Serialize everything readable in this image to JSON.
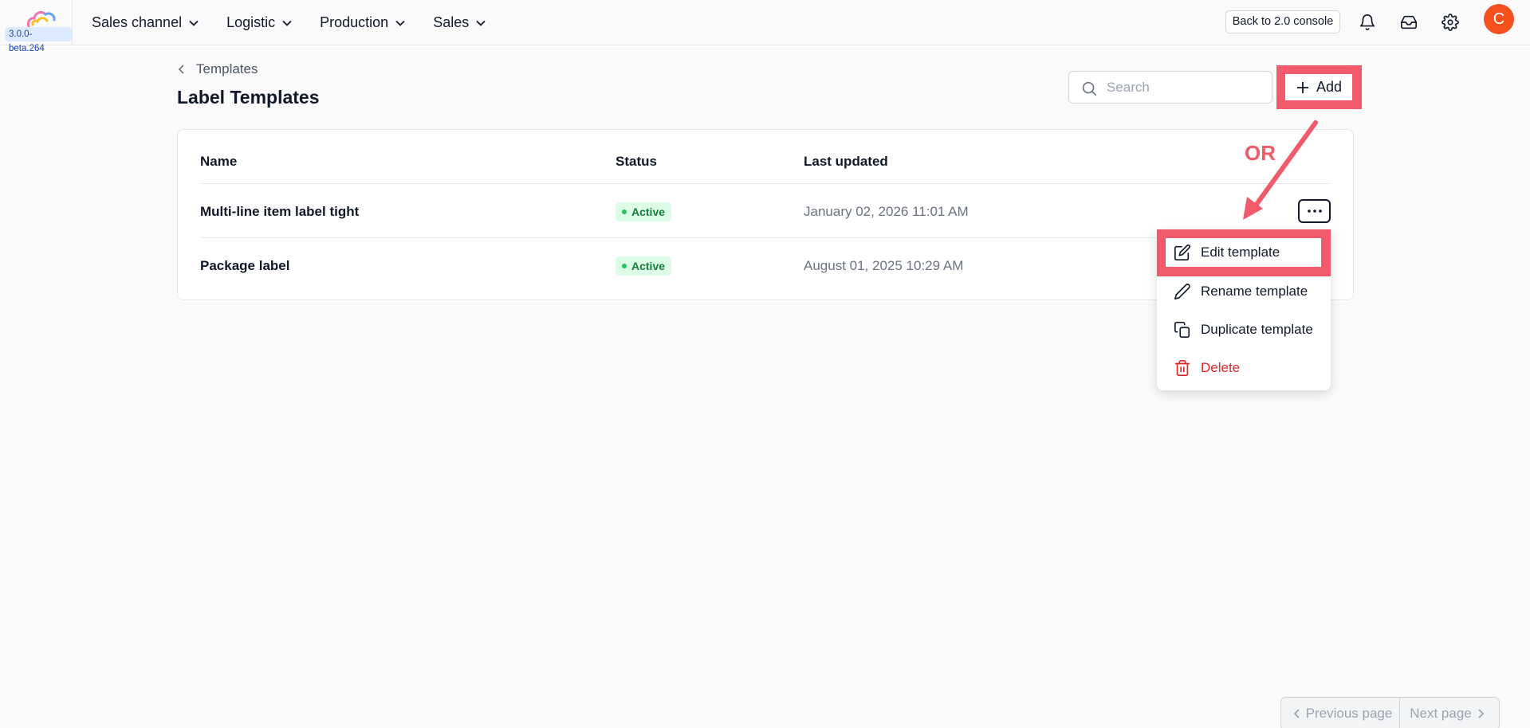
{
  "topbar": {
    "version": "3.0.0-beta.264",
    "nav": [
      {
        "label": "Sales channel"
      },
      {
        "label": "Logistic"
      },
      {
        "label": "Production"
      },
      {
        "label": "Sales"
      }
    ],
    "back_button": "Back to 2.0 console",
    "avatar_initial": "C"
  },
  "page": {
    "breadcrumb": "Templates",
    "title": "Label Templates",
    "search_placeholder": "Search",
    "add_label": "Add"
  },
  "table": {
    "columns": [
      "Name",
      "Status",
      "Last updated"
    ],
    "rows": [
      {
        "name": "Multi-line item label tight",
        "status": "Active",
        "updated": "January 02, 2026 11:01 AM"
      },
      {
        "name": "Package label",
        "status": "Active",
        "updated": "August 01, 2025 10:29 AM"
      }
    ]
  },
  "annotation": {
    "or_text": "OR",
    "highlight_color": "#f05a6b"
  },
  "menu": {
    "items": [
      {
        "label": "Edit template",
        "icon": "edit-icon"
      },
      {
        "label": "Rename template",
        "icon": "pencil-icon"
      },
      {
        "label": "Duplicate template",
        "icon": "copy-icon"
      },
      {
        "label": "Delete",
        "icon": "trash-icon"
      }
    ]
  },
  "pagination": {
    "prev_label": "Previous page",
    "next_label": "Next page"
  },
  "colors": {
    "active_badge_bg": "#dcfce7",
    "active_badge_text": "#15803d",
    "danger": "#dc2626",
    "avatar_bg": "#f4511e"
  }
}
